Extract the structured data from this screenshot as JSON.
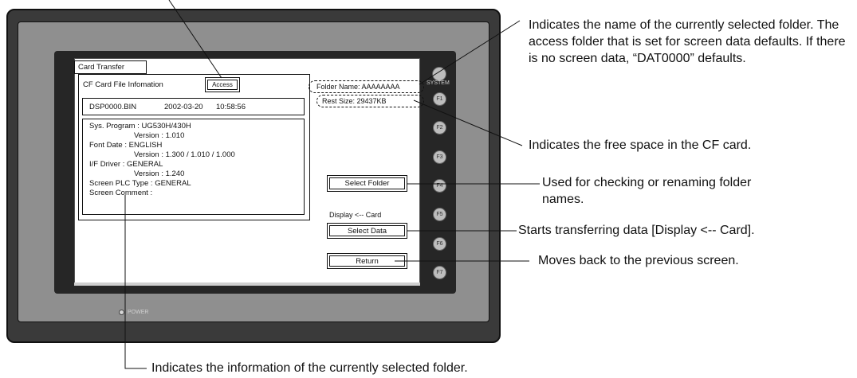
{
  "screen": {
    "card_transfer_tab": "Card Transfer",
    "cf_info_label": "CF Card File Infomation",
    "access_button": "Access",
    "file_name": "DSP0000.BIN",
    "file_date": "2002-03-20",
    "file_time": "10:58:56",
    "info_lines": [
      "Sys. Program    : UG530H/430H",
      "Version : 1.010",
      "Font Date         : ENGLISH",
      "Version : 1.300 / 1.010 / 1.000",
      "I/F Driver          : GENERAL",
      "Version : 1.240",
      "Screen PLC Type : GENERAL",
      "Screen Comment :"
    ],
    "folder_name": "Folder Name: AAAAAAAA",
    "rest_size": "Rest Size:    29437KB",
    "select_folder_button": "Select Folder",
    "display_card_label": "Display <-- Card",
    "select_data_button": "Select Data",
    "return_button": "Return"
  },
  "device": {
    "system_key": "SYSTEM",
    "function_keys": [
      "F1",
      "F2",
      "F3",
      "F4",
      "F5",
      "F6",
      "F7"
    ],
    "power_label": "POWER"
  },
  "callouts": {
    "folder_name": "Indicates the name of the currently selected folder.  The access folder that is set for screen data defaults. If there is no screen data, “DAT0000” defaults.",
    "free_space": "Indicates the free space in the CF card.",
    "select_folder": "Used for checking or renaming folder names.",
    "select_data": "Starts transferring data [Display <-- Card].",
    "return": "Moves back to the previous screen.",
    "folder_info": "Indicates the information of the currently selected folder."
  }
}
